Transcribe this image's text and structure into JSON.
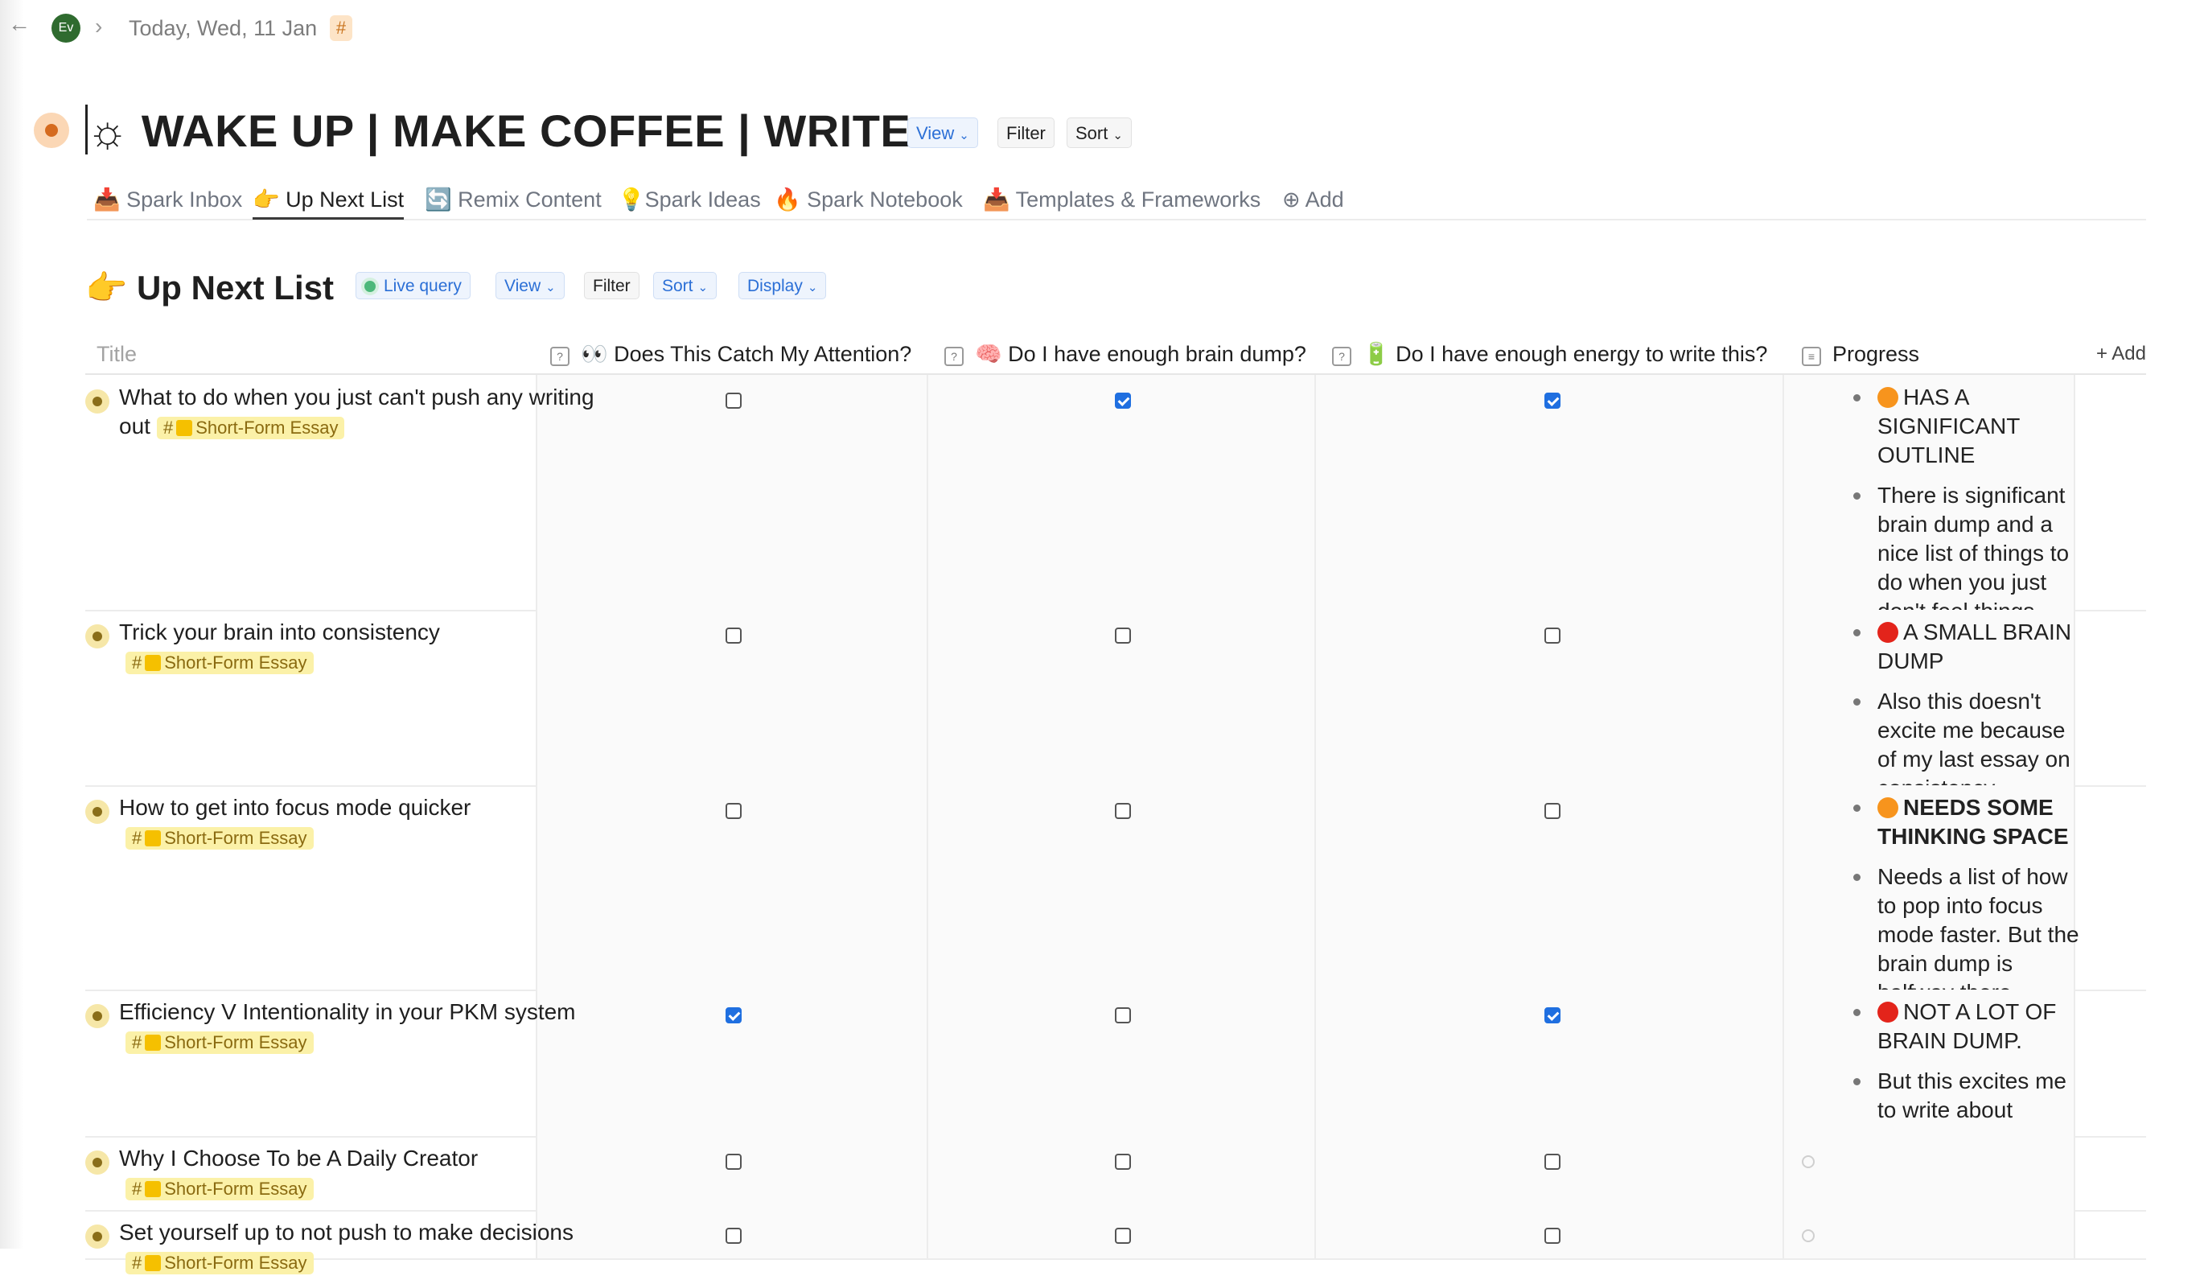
{
  "breadcrumb": {
    "avatar": "Ev",
    "date": "Today, Wed, 11 Jan",
    "hash": "#"
  },
  "page": {
    "title": "☼ WAKE UP | MAKE COFFEE | WRITE",
    "view": "View",
    "filter": "Filter",
    "sort": "Sort"
  },
  "tabs": [
    {
      "label": "📥 Spark Inbox"
    },
    {
      "label": "👉 Up Next List"
    },
    {
      "label": "🔄 Remix Content"
    },
    {
      "label": "💡Spark Ideas"
    },
    {
      "label": "🔥 Spark Notebook"
    },
    {
      "label": "📥 Templates & Frameworks"
    },
    {
      "label": "⊕  Add"
    }
  ],
  "section": {
    "title": "👉 Up Next List",
    "live_query": "Live query",
    "view": "View",
    "filter": "Filter",
    "sort": "Sort",
    "display": "Display"
  },
  "table": {
    "columns": {
      "title": "Title",
      "q1": "👀 Does This Catch My Attention?",
      "q2": "🧠 Do I have enough brain dump?",
      "q3": "🔋 Do I have enough energy to write this?",
      "progress": "Progress",
      "add": "+ Add"
    },
    "tag_label": "Short-Form Essay",
    "rows": [
      {
        "title": "What to do when you just can't push any writing out",
        "q1": false,
        "q2": true,
        "q3": true,
        "progress": [
          {
            "status": "orange",
            "text": "HAS A SIGNIFICANT OUTLINE"
          },
          {
            "text": "There is significant brain dump and a nice list of things to do when you just don't feel things flowing."
          }
        ]
      },
      {
        "title": "Trick your brain into consistency",
        "q1": false,
        "q2": false,
        "q3": false,
        "progress": [
          {
            "status": "red",
            "text": "A SMALL BRAIN DUMP"
          },
          {
            "text": "Also this doesn't excite me because of my last essay on consistency"
          }
        ]
      },
      {
        "title": "How to get into focus mode quicker",
        "q1": false,
        "q2": false,
        "q3": false,
        "progress": [
          {
            "status": "orange",
            "text": "NEEDS SOME THINKING SPACE",
            "bold": true
          },
          {
            "text": "Needs a list of how to pop into focus mode faster. But the brain dump is halfway there"
          }
        ]
      },
      {
        "title": "Efficiency V Intentionality in your PKM system",
        "q1": true,
        "q2": false,
        "q3": true,
        "progress": [
          {
            "status": "red",
            "text": "NOT A LOT OF BRAIN DUMP."
          },
          {
            "text": "But this excites me to write about"
          }
        ]
      },
      {
        "title": "Why I Choose To be A Daily Creator",
        "q1": false,
        "q2": false,
        "q3": false,
        "progress": []
      },
      {
        "title": "Set yourself up to not push to make decisions",
        "q1": false,
        "q2": false,
        "q3": false,
        "progress": []
      }
    ]
  }
}
